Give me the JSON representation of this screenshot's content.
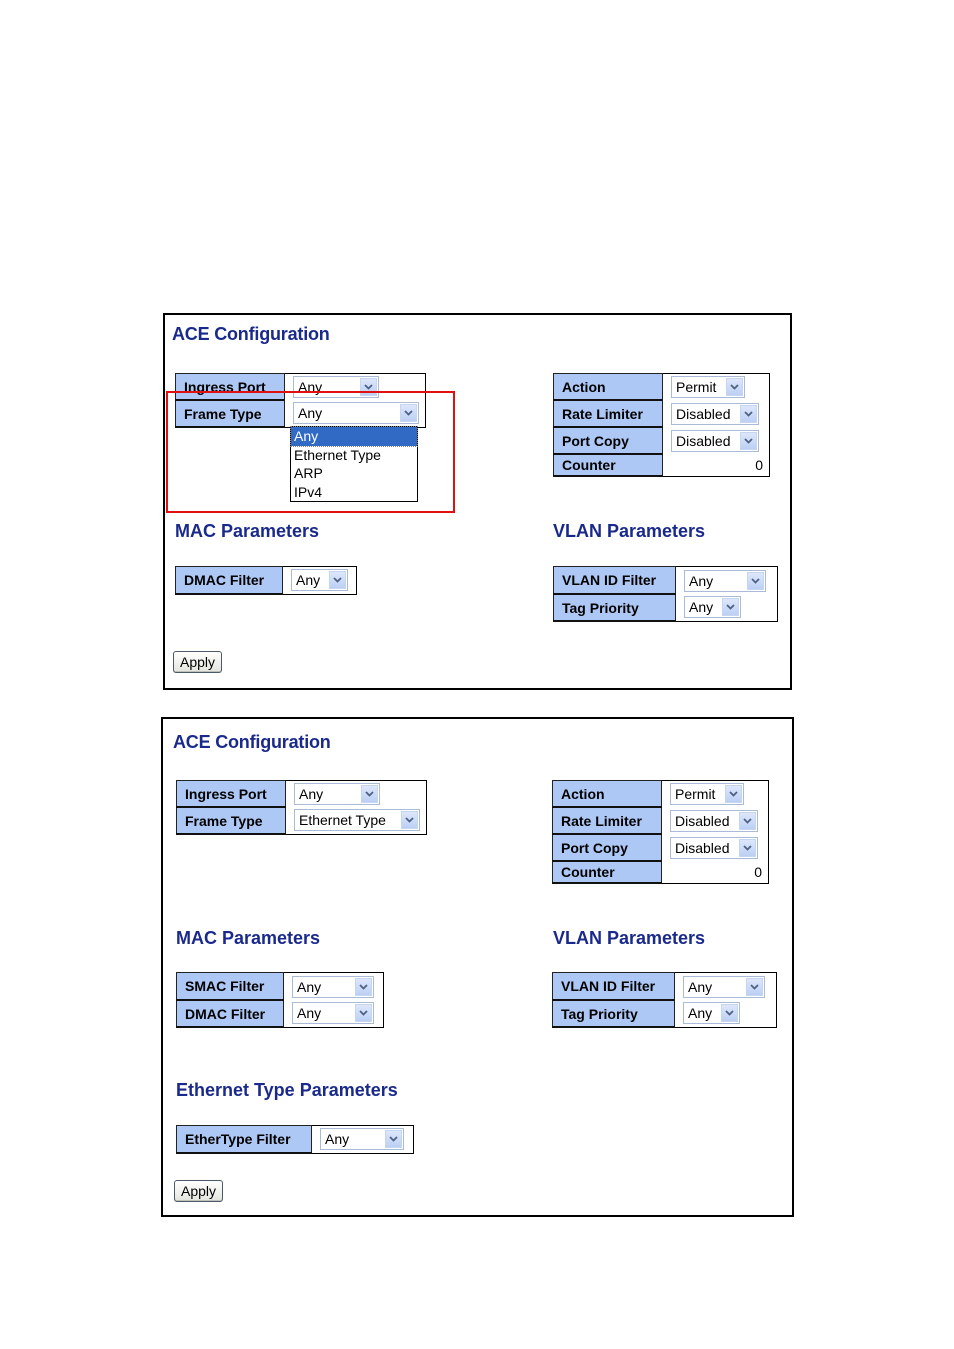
{
  "colors": {
    "heading": "#1a2a8c",
    "label_bg": "#aec8f5",
    "highlight": "#e01010",
    "selected_option": "#316ac5"
  },
  "panel1": {
    "title": "ACE Configuration",
    "ingress_port": {
      "label": "Ingress Port",
      "value": "Any"
    },
    "frame_type": {
      "label": "Frame Type",
      "value": "Any",
      "dropdown_open": true,
      "options": [
        "Any",
        "Ethernet Type",
        "ARP",
        "IPv4"
      ],
      "selected_option": "Any"
    },
    "action": {
      "label": "Action",
      "value": "Permit"
    },
    "rate_limiter": {
      "label": "Rate Limiter",
      "value": "Disabled"
    },
    "port_copy": {
      "label": "Port Copy",
      "value": "Disabled"
    },
    "counter": {
      "label": "Counter",
      "value": "0"
    },
    "mac_title": "MAC Parameters",
    "dmac_filter": {
      "label": "DMAC Filter",
      "value": "Any"
    },
    "vlan_title": "VLAN Parameters",
    "vlan_id_filter": {
      "label": "VLAN ID Filter",
      "value": "Any"
    },
    "tag_priority": {
      "label": "Tag Priority",
      "value": "Any"
    },
    "apply_label": "Apply"
  },
  "panel2": {
    "title": "ACE Configuration",
    "ingress_port": {
      "label": "Ingress Port",
      "value": "Any"
    },
    "frame_type": {
      "label": "Frame Type",
      "value": "Ethernet Type"
    },
    "action": {
      "label": "Action",
      "value": "Permit"
    },
    "rate_limiter": {
      "label": "Rate Limiter",
      "value": "Disabled"
    },
    "port_copy": {
      "label": "Port Copy",
      "value": "Disabled"
    },
    "counter": {
      "label": "Counter",
      "value": "0"
    },
    "mac_title": "MAC Parameters",
    "smac_filter": {
      "label": "SMAC Filter",
      "value": "Any"
    },
    "dmac_filter": {
      "label": "DMAC Filter",
      "value": "Any"
    },
    "vlan_title": "VLAN Parameters",
    "vlan_id_filter": {
      "label": "VLAN ID Filter",
      "value": "Any"
    },
    "tag_priority": {
      "label": "Tag Priority",
      "value": "Any"
    },
    "ethertype_title": "Ethernet Type Parameters",
    "ethertype_filter": {
      "label": "EtherType Filter",
      "value": "Any"
    },
    "apply_label": "Apply"
  }
}
